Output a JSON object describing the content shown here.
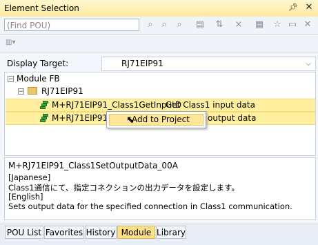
{
  "window": {
    "title": "Element Selection"
  },
  "search": {
    "placeholder": "(Find POU)"
  },
  "display_target": {
    "label": "Display Target:",
    "value": "RJ71EIP91"
  },
  "tree": {
    "root": {
      "label": "Module FB"
    },
    "module": {
      "label": "RJ71EIP91"
    },
    "items": [
      {
        "label": "M+RJ71EIP91_Class1GetInputD",
        "comment": "Get Class1 input data"
      },
      {
        "label": "M+RJ71EIP91_",
        "comment": "output data"
      }
    ]
  },
  "context_menu": {
    "item_label": "Add to Project"
  },
  "description": {
    "title": "M+RJ71EIP91_Class1SetOutputData_00A",
    "lines": [
      "[Japanese]",
      "Class1通信にて、指定コネクションの出力データを設定します。",
      "[English]",
      "Sets output data for the specified connection in Class1 communication."
    ]
  },
  "tabs": [
    "POU List",
    "Favorites",
    "History",
    "Module",
    "Library"
  ],
  "active_tab": "Module"
}
